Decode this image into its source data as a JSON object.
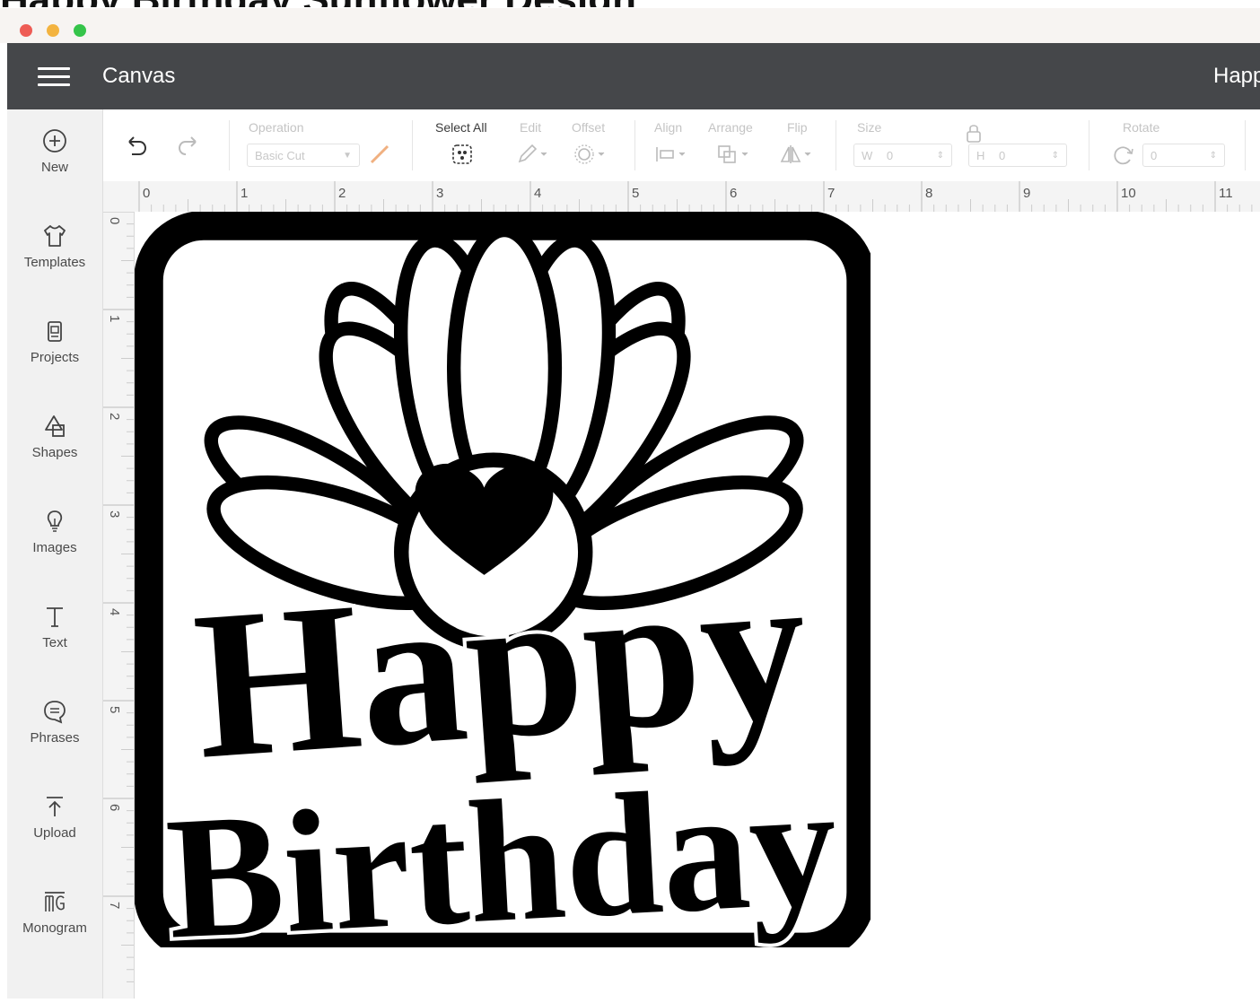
{
  "window": {
    "heading_fragment": "Happy Birthday Sunflower Design"
  },
  "appbar": {
    "title": "Canvas",
    "project_name": "Happy Birthday"
  },
  "sidebar": {
    "items": [
      {
        "label": "New",
        "icon": "plus-circle-icon"
      },
      {
        "label": "Templates",
        "icon": "shirt-icon"
      },
      {
        "label": "Projects",
        "icon": "projects-icon"
      },
      {
        "label": "Shapes",
        "icon": "shapes-icon"
      },
      {
        "label": "Images",
        "icon": "lightbulb-icon"
      },
      {
        "label": "Text",
        "icon": "text-icon"
      },
      {
        "label": "Phrases",
        "icon": "speech-bubble-icon"
      },
      {
        "label": "Upload",
        "icon": "upload-icon"
      },
      {
        "label": "Monogram",
        "icon": "monogram-icon"
      }
    ]
  },
  "toolbar": {
    "operation_label": "Operation",
    "operation_value": "Basic Cut",
    "select_all_label": "Select All",
    "edit_label": "Edit",
    "offset_label": "Offset",
    "align_label": "Align",
    "arrange_label": "Arrange",
    "flip_label": "Flip",
    "size_label": "Size",
    "w_label": "W",
    "w_value": "0",
    "h_label": "H",
    "h_value": "0",
    "rotate_label": "Rotate",
    "rotate_value": "0"
  },
  "rulers": {
    "top_ticks": [
      "0",
      "1",
      "2",
      "3",
      "4",
      "5",
      "6",
      "7",
      "8",
      "9",
      "10",
      "11"
    ],
    "left_ticks": [
      "0",
      "1",
      "2",
      "3",
      "4",
      "5",
      "6",
      "7"
    ]
  },
  "design": {
    "line1": "Happy",
    "line2": "Birthday",
    "color": "#000000"
  }
}
